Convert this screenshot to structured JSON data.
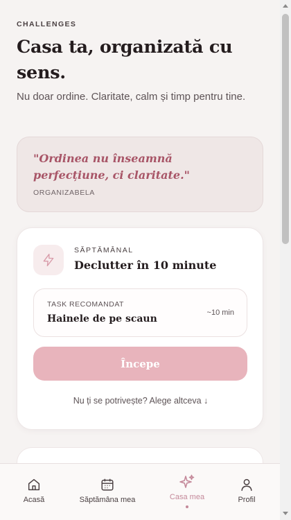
{
  "header": {
    "eyebrow": "CHALLENGES",
    "title": "Casa ta, organizată cu sens.",
    "subtitle": "Nu doar ordine. Claritate, calm și timp pentru tine."
  },
  "quote": {
    "text": "\"Ordinea nu înseamnă perfecțiune, ci claritate.\"",
    "author": "ORGANIZABELA"
  },
  "weekly": {
    "icon": "bolt-icon",
    "label": "SĂPTĂMÂNAL",
    "title": "Declutter în 10 minute",
    "task": {
      "label": "TASK RECOMANDAT",
      "name": "Hainele de pe scaun",
      "time": "~10 min"
    },
    "start_label": "Începe",
    "alt_label": "Nu ți se potrivește? Alege altceva ↓"
  },
  "nav": {
    "items": [
      {
        "label": "Acasă",
        "icon": "home-icon"
      },
      {
        "label": "Săptămâna mea",
        "icon": "calendar-icon"
      },
      {
        "label": "Casa mea",
        "icon": "sparkles-icon",
        "active": true
      },
      {
        "label": "Profil",
        "icon": "user-icon"
      }
    ]
  },
  "colors": {
    "accent": "#c4899a",
    "quote": "#a85567",
    "button": "#e8b4bc",
    "background": "#f6f3f2"
  }
}
